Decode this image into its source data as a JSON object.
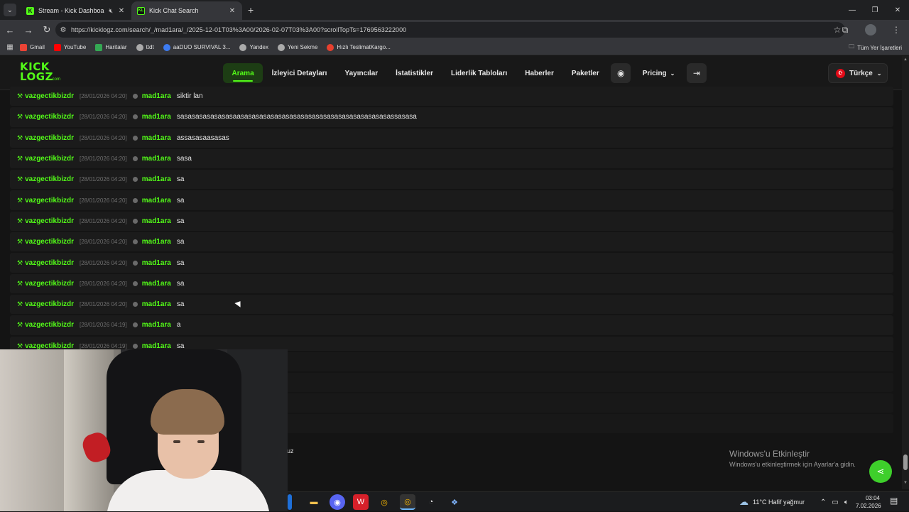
{
  "browser": {
    "tabs": [
      {
        "title": "Stream - Kick Dashboard",
        "icon": "kick-favicon",
        "muted": true,
        "active": false
      },
      {
        "title": "Kick Chat Search",
        "icon": "kicklogz-favicon",
        "active": true
      }
    ],
    "url": "https://kicklogz.com/search/_/mad1ara/_/2025-12-01T03%3A00/2026-02-07T03%3A00?scrollTopTs=1769563222000",
    "bookmarks": [
      {
        "label": "Gmail",
        "color": "#ea4335"
      },
      {
        "label": "YouTube",
        "color": "#ff0000"
      },
      {
        "label": "Haritalar",
        "color": "#34a853"
      },
      {
        "label": "ttdt",
        "color": "#aaaaaa"
      },
      {
        "label": "aaDUO SURVIVAL 3...",
        "color": "#3d7cf2"
      },
      {
        "label": "Yandex",
        "color": "#aaaaaa"
      },
      {
        "label": "Yeni Sekme",
        "color": "#aaaaaa"
      },
      {
        "label": "Hızlı TeslimatKargo...",
        "color": "#e8402e"
      }
    ],
    "all_bookmarks_label": "Tüm Yer İşaretleri"
  },
  "site": {
    "logo_line1": "KICK",
    "logo_line2": "LOGZ",
    "logo_suffix": ".com",
    "nav": [
      {
        "label": "Arama",
        "active": true
      },
      {
        "label": "İzleyici Detayları"
      },
      {
        "label": "Yayıncılar"
      },
      {
        "label": "İstatistikler"
      },
      {
        "label": "Liderlik Tabloları"
      },
      {
        "label": "Haberler"
      },
      {
        "label": "Paketler"
      }
    ],
    "pricing_label": "Pricing",
    "language": "Türkçe",
    "accent_color": "#53fc18"
  },
  "chat": {
    "rows": [
      {
        "channel": "vazgectikbizdr",
        "time": "[28/01/2026 04:20]",
        "user": "mad1ara",
        "message": "siktir lan"
      },
      {
        "channel": "vazgectikbizdr",
        "time": "[28/01/2026 04:20]",
        "user": "mad1ara",
        "message": "sasasasasasasasaasasasasasasasasasasasasasasasasasasasasassasasa"
      },
      {
        "channel": "vazgectikbizdr",
        "time": "[28/01/2026 04:20]",
        "user": "mad1ara",
        "message": "assasasaasasas"
      },
      {
        "channel": "vazgectikbizdr",
        "time": "[28/01/2026 04:20]",
        "user": "mad1ara",
        "message": "sasa"
      },
      {
        "channel": "vazgectikbizdr",
        "time": "[28/01/2026 04:20]",
        "user": "mad1ara",
        "message": "sa"
      },
      {
        "channel": "vazgectikbizdr",
        "time": "[28/01/2026 04:20]",
        "user": "mad1ara",
        "message": "sa"
      },
      {
        "channel": "vazgectikbizdr",
        "time": "[28/01/2026 04:20]",
        "user": "mad1ara",
        "message": "sa"
      },
      {
        "channel": "vazgectikbizdr",
        "time": "[28/01/2026 04:20]",
        "user": "mad1ara",
        "message": "sa"
      },
      {
        "channel": "vazgectikbizdr",
        "time": "[28/01/2026 04:20]",
        "user": "mad1ara",
        "message": "sa"
      },
      {
        "channel": "vazgectikbizdr",
        "time": "[28/01/2026 04:20]",
        "user": "mad1ara",
        "message": "sa"
      },
      {
        "channel": "vazgectikbizdr",
        "time": "[28/01/2026 04:20]",
        "user": "mad1ara",
        "message": "sa"
      },
      {
        "channel": "vazgectikbizdr",
        "time": "[28/01/2026 04:19]",
        "user": "mad1ara",
        "message": "a"
      },
      {
        "channel": "vazgectikbizdr",
        "time": "[28/01/2026 04:19]",
        "user": "mad1ara",
        "message": "sa"
      }
    ],
    "stray_text": "uz"
  },
  "windows": {
    "activation_title": "Windows'u Etkinleştir",
    "activation_sub": "Windows'u etkinleştirmek için Ayarlar'a gidin.",
    "weather": "11°C  Hafif yağmur",
    "time": "03:04",
    "date": "7.02.2026"
  }
}
